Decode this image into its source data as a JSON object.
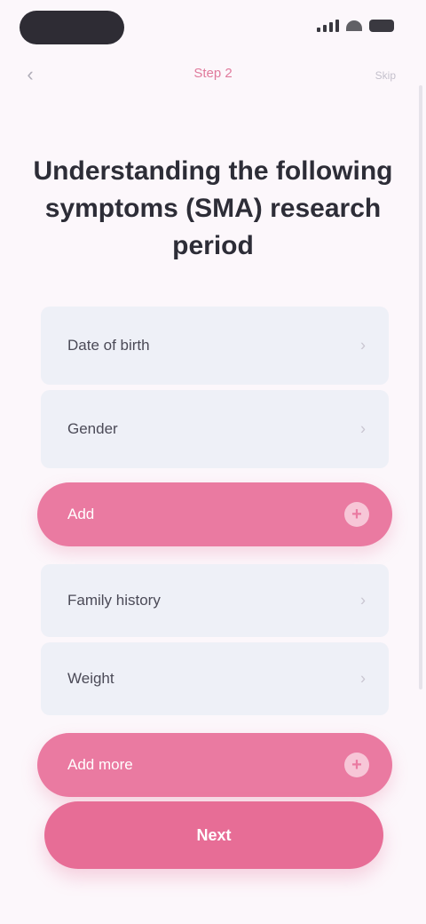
{
  "status_bar": {
    "icons": [
      "signal-icon",
      "wifi-icon",
      "battery-icon"
    ]
  },
  "nav": {
    "back_icon": "chevron-left-icon",
    "title": "Step 2",
    "right_text": "Skip"
  },
  "prompt": {
    "text": "Understanding the following symptoms (SMA) research period"
  },
  "fields": [
    {
      "label": "Date of birth",
      "chevron": "›"
    },
    {
      "label": "Gender",
      "chevron": "›"
    },
    {
      "label": "Family history",
      "chevron": "›"
    },
    {
      "label": "Weight",
      "chevron": "›"
    }
  ],
  "pink_rows": [
    {
      "label": "Add",
      "plus": "+"
    },
    {
      "label": "Add more",
      "plus": "+"
    }
  ],
  "submit": {
    "label": "Next"
  },
  "colors": {
    "accent": "#e76d96",
    "field_bg": "#eef0f7",
    "background": "#fcf7fb"
  }
}
